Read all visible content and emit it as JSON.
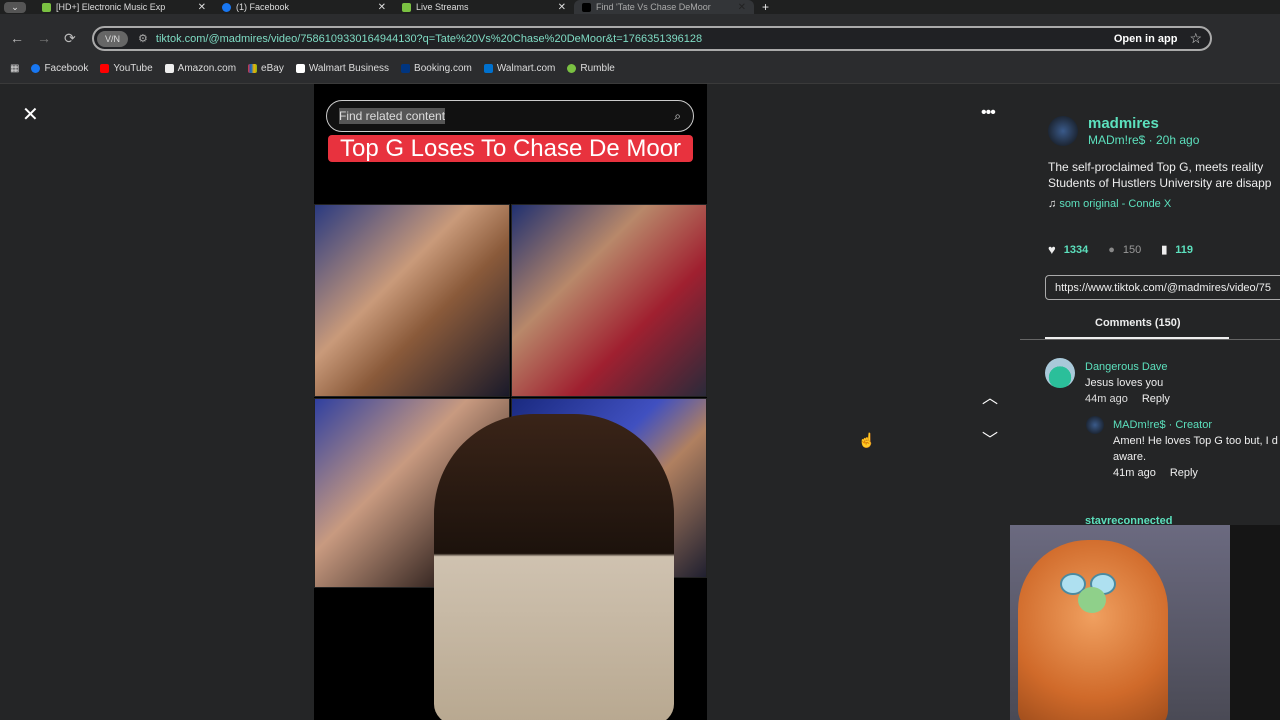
{
  "tabs": [
    {
      "label": "[HD+] Electronic Music Exp"
    },
    {
      "label": "(1) Facebook"
    },
    {
      "label": "Live Streams"
    },
    {
      "label": "Find 'Tate Vs Chase DeMoor"
    }
  ],
  "address": {
    "badge": "V/N",
    "url": "tiktok.com/@madmires/video/7586109330164944130?q=Tate%20Vs%20Chase%20DeMoor&t=1766351396128",
    "open_in_app": "Open in app"
  },
  "bookmarks": [
    "Facebook",
    "YouTube",
    "Amazon.com",
    "eBay",
    "Walmart Business",
    "Booking.com",
    "Walmart.com",
    "Rumble"
  ],
  "video": {
    "search_placeholder": "Find related content",
    "title": "Top G Loses To Chase De Moor"
  },
  "post": {
    "username": "madmires",
    "nickname_time": "MADm!re$ · 20h ago",
    "description_1": "The self-proclaimed Top G, meets reality",
    "description_2": "Students of Hustlers University are disapp",
    "sound": "som original - Conde X",
    "likes": "1334",
    "comments": "150",
    "saves": "119",
    "link": "https://www.tiktok.com/@madmires/video/75",
    "comments_tab": "Comments (150)"
  },
  "comments": [
    {
      "author": "Dangerous Dave",
      "text": "Jesus loves you",
      "time": "44m ago",
      "reply": "Reply"
    },
    {
      "author": "MADm!re$ · Creator",
      "text": "Amen! He loves Top G too but, I d",
      "text2": "aware.",
      "time": "41m ago",
      "reply": "Reply"
    },
    {
      "author": "stavreconnected"
    }
  ],
  "colors": {
    "accent": "#5ce0bd",
    "title_bg": "#e8323e"
  }
}
